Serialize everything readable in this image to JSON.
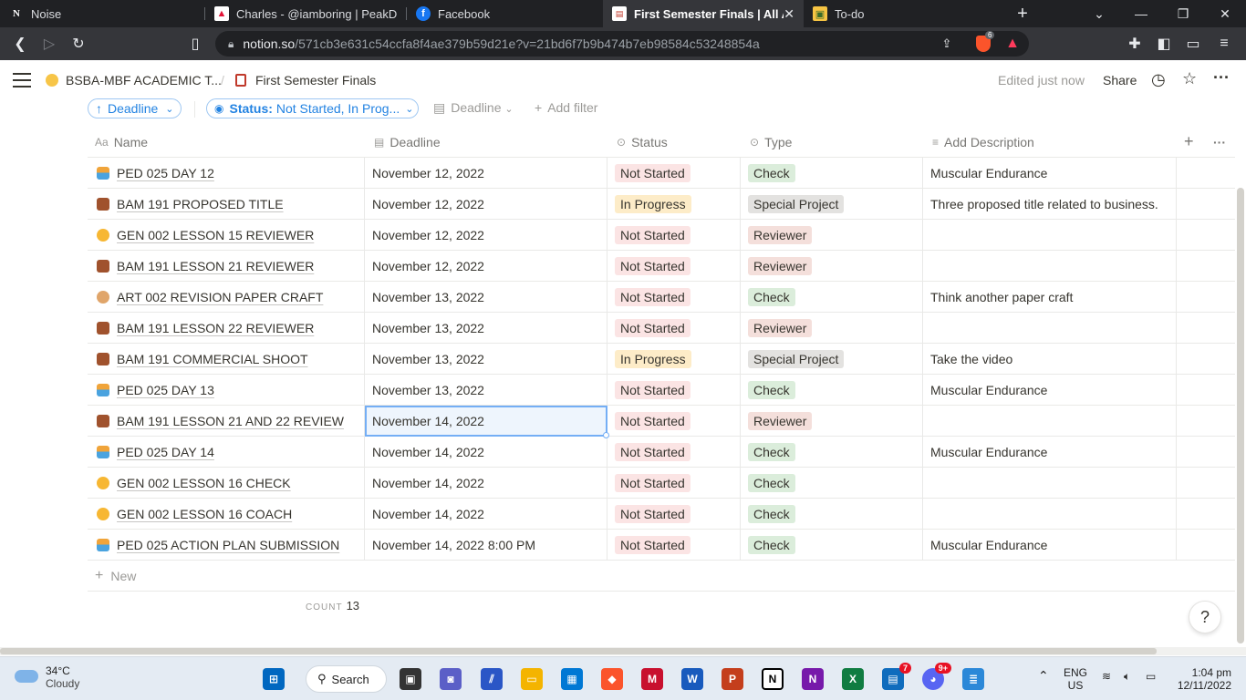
{
  "browser": {
    "tabs": [
      {
        "label": "Noise",
        "icon": "notion-icon"
      },
      {
        "label": "Charles - @iamboring | PeakD",
        "icon": "peakd-icon"
      },
      {
        "label": "Facebook",
        "icon": "facebook-icon"
      },
      {
        "label": "First Semester Finals | All Acad",
        "icon": "notion-page-icon",
        "active": true
      },
      {
        "label": "To-do",
        "icon": "todo-icon"
      }
    ],
    "url_host": "notion.so",
    "url_path": "/571cb3e631c54ccfa8f4ae379b59d21e?v=21bd6f7b9b474b7eb98584c53248854a",
    "brave_badge": "6"
  },
  "notion": {
    "breadcrumb": [
      "BSBA-MBF ACADEMIC T...",
      "First Semester Finals"
    ],
    "edited": "Edited just now",
    "share": "Share"
  },
  "filters": {
    "sort_label": "Deadline",
    "status_key": "Status:",
    "status_value": "Not Started, In Prog...",
    "deadline_label": "Deadline",
    "add_filter": "Add filter"
  },
  "table": {
    "headers": {
      "name": "Name",
      "deadline": "Deadline",
      "status": "Status",
      "type": "Type",
      "desc": "Add Description"
    },
    "rows": [
      {
        "name": "PED 025 DAY 12",
        "deadline": "November 12, 2022",
        "status": "Not Started",
        "type": "Check",
        "desc": "Muscular Endurance",
        "icon": "swimmer"
      },
      {
        "name": "BAM 191 PROPOSED TITLE",
        "deadline": "November 12, 2022",
        "status": "In Progress",
        "type": "Special Project",
        "desc": "Three proposed title related to business.",
        "icon": "briefcase"
      },
      {
        "name": "GEN 002 LESSON 15 REVIEWER",
        "deadline": "November 12, 2022",
        "status": "Not Started",
        "type": "Reviewer",
        "desc": "",
        "icon": "face"
      },
      {
        "name": "BAM 191 LESSON 21 REVIEWER",
        "deadline": "November 12, 2022",
        "status": "Not Started",
        "type": "Reviewer",
        "desc": "",
        "icon": "briefcase"
      },
      {
        "name": "ART 002 REVISION PAPER CRAFT",
        "deadline": "November 13, 2022",
        "status": "Not Started",
        "type": "Check",
        "desc": "Think another paper craft",
        "icon": "palette"
      },
      {
        "name": "BAM 191 LESSON 22 REVIEWER",
        "deadline": "November 13, 2022",
        "status": "Not Started",
        "type": "Reviewer",
        "desc": "",
        "icon": "briefcase"
      },
      {
        "name": "BAM 191 COMMERCIAL SHOOT",
        "deadline": "November 13, 2022",
        "status": "In Progress",
        "type": "Special Project",
        "desc": "Take the video",
        "icon": "briefcase"
      },
      {
        "name": "PED 025 DAY 13",
        "deadline": "November 13, 2022",
        "status": "Not Started",
        "type": "Check",
        "desc": "Muscular Endurance",
        "icon": "swimmer"
      },
      {
        "name": "BAM 191 LESSON 21 AND 22 REVIEW",
        "deadline": "November 14, 2022",
        "status": "Not Started",
        "type": "Reviewer",
        "desc": "",
        "icon": "briefcase",
        "selected": true
      },
      {
        "name": "PED 025 DAY 14",
        "deadline": "November 14, 2022",
        "status": "Not Started",
        "type": "Check",
        "desc": "Muscular Endurance",
        "icon": "swimmer"
      },
      {
        "name": "GEN 002 LESSON 16 CHECK",
        "deadline": "November 14, 2022",
        "status": "Not Started",
        "type": "Check",
        "desc": "",
        "icon": "face"
      },
      {
        "name": "GEN 002 LESSON 16 COACH",
        "deadline": "November 14, 2022",
        "status": "Not Started",
        "type": "Check",
        "desc": "",
        "icon": "face"
      },
      {
        "name": "PED 025 ACTION PLAN SUBMISSION",
        "deadline": "November 14, 2022 8:00 PM",
        "status": "Not Started",
        "type": "Check",
        "desc": "Muscular Endurance",
        "icon": "swimmer"
      }
    ],
    "new_label": "New",
    "count_label": "COUNT",
    "count_value": "13"
  },
  "colors": {
    "not_started_bg": "#fbe4e4",
    "in_progress_bg": "#fdecc8",
    "check_bg": "#dbeddb",
    "special_bg": "#e3e2e0",
    "reviewer_bg": "#f4dfdb"
  },
  "help_label": "?",
  "taskbar": {
    "weather_temp": "34°C",
    "weather_desc": "Cloudy",
    "search_label": "Search",
    "lang": "ENG",
    "region": "US",
    "time": "1:04 pm",
    "date": "12/11/2022",
    "badge_outlook": "7",
    "badge_discord": "9+"
  }
}
